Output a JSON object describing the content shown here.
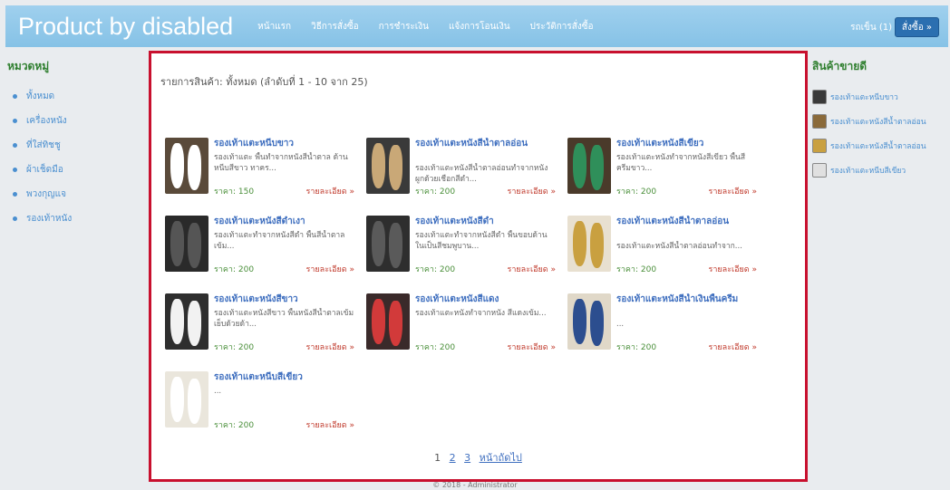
{
  "header": {
    "brand": "Product by disabled",
    "nav": [
      "หน้าแรก",
      "วิธีการสั่งซื้อ",
      "การชำระเงิน",
      "แจ้งการโอนเงิน",
      "ประวัติการสั่งซื้อ"
    ],
    "cart": "รถเข็น (1)",
    "order_button": "สั่งซื้อ »"
  },
  "left": {
    "heading": "หมวดหมู่",
    "categories": [
      "ทั้งหมด",
      "เครื่องหนัง",
      "ที่ใส่ทิชชู",
      "ผ้าเช็ดมือ",
      "พวงกุญแจ",
      "รองเท้าหนัง"
    ]
  },
  "main": {
    "listing_title": "รายการสินค้า: ทั้งหมด (ลำดับที่ 1 - 10 จาก 25)",
    "price_label": "ราคา:",
    "detail_label": "รายละเอียด »",
    "products": [
      {
        "name": "รองเท้าแตะหนีบขาว",
        "desc": "รองเท้าแตะ พื้นทำจากหนังสีน้ำตาล ด้านหนีบสีขาว ทาคร...",
        "price": "150",
        "bg": "#5a4a3a",
        "shoe": "#ffffff"
      },
      {
        "name": "รองเท้าแตะหนังสีน้ำตาลอ่อน",
        "desc": "รองเท้าแตะหนังสีน้ำตาลอ่อนทำจากหนัง ผูกด้วยเชือกสีดำ...",
        "price": "200",
        "bg": "#3a3a3a",
        "shoe": "#c9a877"
      },
      {
        "name": "รองเท้าแตะหนังสีเขียว",
        "desc": "รองเท้าแตะหนังทำจากหนังสีเขียว พื้นสีครีมขาว...",
        "price": "200",
        "bg": "#4a3a2a",
        "shoe": "#2f8f5a"
      },
      {
        "name": "รองเท้าแตะหนังสีดำเงา",
        "desc": "รองเท้าแตะทำจากหนังสีดำ พื้นสีน้ำตาลเข้ม...",
        "price": "200",
        "bg": "#2a2a2a",
        "shoe": "#555555"
      },
      {
        "name": "รองเท้าแตะหนังสีดำ",
        "desc": "รองเท้าแตะทำจากหนังสีดำ พื้นขอบด้านในเป็นสีชมพูบาน...",
        "price": "200",
        "bg": "#2e2e2e",
        "shoe": "#5a5a5a"
      },
      {
        "name": "รองเท้าแตะหนังสีน้ำตาลอ่อน",
        "desc": "รองเท้าแตะหนังสีน้ำตาลอ่อนทำจาก...",
        "price": "200",
        "bg": "#e8e0d0",
        "shoe": "#c9a040"
      },
      {
        "name": "รองเท้าแตะหนังสีขาว",
        "desc": "รองเท้าแตะหนังสีขาว พื้นหนังสีน้ำตาลเข้ม เย็บด้วยด้า...",
        "price": "200",
        "bg": "#2e2e2e",
        "shoe": "#f2f2f2"
      },
      {
        "name": "รองเท้าแตะหนังสีแดง",
        "desc": "รองเท้าแตะหนังทำจากหนัง สีแดงเข้ม...",
        "price": "200",
        "bg": "#3a2a2a",
        "shoe": "#d23a3a"
      },
      {
        "name": "รองเท้าแตะหนังสีน้ำเงินพื้นครีม",
        "desc": "...",
        "price": "200",
        "bg": "#e0d8c8",
        "shoe": "#2c4e8f"
      },
      {
        "name": "รองเท้าแตะหนีบสีเขียว",
        "desc": "...",
        "price": "200",
        "bg": "#eae6dc",
        "shoe": "#ffffff"
      }
    ],
    "pagination": {
      "current": "1",
      "pages": [
        "2",
        "3"
      ],
      "next": "หน้าถัดไป"
    }
  },
  "right": {
    "heading": "สินค้าขายดี",
    "items": [
      {
        "label": "รองเท้าแตะหนีบขาว",
        "color": "#3a3a3a"
      },
      {
        "label": "รองเท้าแตะหนังสีน้ำตาลอ่อน",
        "color": "#8a6a3a"
      },
      {
        "label": "รองเท้าแตะหนังสีน้ำตาลอ่อน",
        "color": "#c9a040"
      },
      {
        "label": "รองเท้าแตะหนีบสีเขียว",
        "color": "#e0e0e0"
      }
    ]
  },
  "footer": "© 2018 - Administrator",
  "colors": {
    "topbar": "#8cc6e8",
    "frame": "#c8102e",
    "link": "#3f6fbf",
    "price": "#4a8f3a",
    "detail": "#c0392b",
    "category_heading": "#2f7f2f"
  }
}
